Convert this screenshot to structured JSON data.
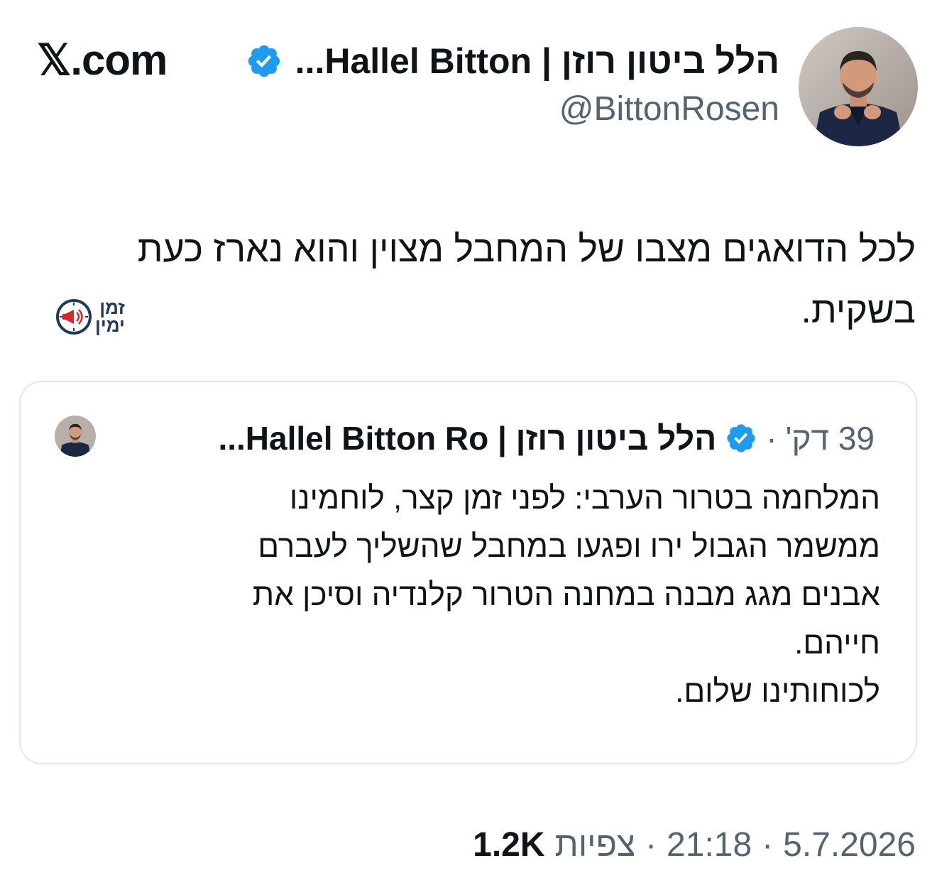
{
  "header": {
    "site_label": "𝕏.com",
    "display_name": "הלל ביטון רוזן | Hallel Bitton...",
    "handle": "@BittonRosen",
    "verified": true,
    "badge_color": "#1d9bf0"
  },
  "tweet": {
    "text": "לכל הדואגים מצבו של המחבל מצוין והוא נארז כעת בשקית."
  },
  "watermark": {
    "line1": "זמן",
    "line2": "ימין",
    "icon": "clock-megaphone-icon",
    "accent": "#d62828"
  },
  "quoted": {
    "display_name": "הלל ביטון רוזן | Hallel Bitton Ro...",
    "time": "39 דק'",
    "text_lines": [
      "המלחמה בטרור הערבי: לפני זמן קצר, לוחמינו",
      "ממשמר הגבול ירו ופגעו במחבל שהשליך לעברם",
      "אבנים מגג מבנה במחנה הטרור קלנדיה וסיכן את",
      "חייהם.",
      "לכוחותינו שלום."
    ]
  },
  "footer": {
    "date": "5.7.2026",
    "time": "21:18",
    "views_label": "צפיות",
    "views_count": "1.2K",
    "separator": "·"
  }
}
